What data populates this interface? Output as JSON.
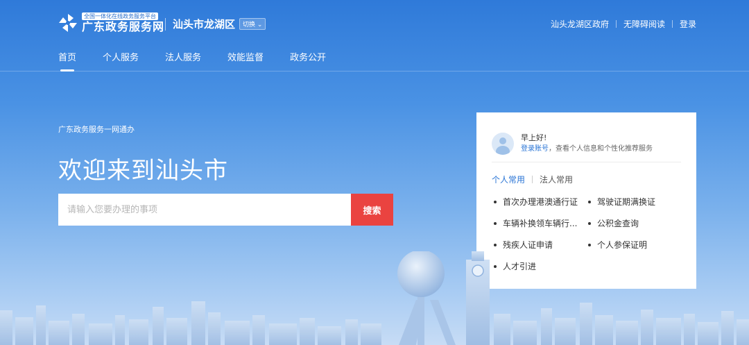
{
  "header": {
    "logo_tag": "全国一体化在线政务服务平台",
    "logo_name": "广东政务服务网",
    "city": "汕头市龙湖区",
    "switch_label": "切换",
    "links": [
      "汕头龙湖区政府",
      "无障碍阅读",
      "登录"
    ]
  },
  "nav": {
    "items": [
      "首页",
      "个人服务",
      "法人服务",
      "效能监督",
      "政务公开"
    ],
    "active": "首页"
  },
  "hero": {
    "subtitle": "广东政务服务一网通办",
    "title": "欢迎来到汕头市"
  },
  "search": {
    "placeholder": "请输入您要办理的事项",
    "button": "搜索"
  },
  "panel": {
    "greeting": "早上好!",
    "login_link": "登录账号",
    "login_desc": "，查看个人信息和个性化推荐服务",
    "tabs": [
      "个人常用",
      "法人常用"
    ],
    "active_tab": "个人常用",
    "services": [
      "首次办理港澳通行证",
      "驾驶证期满换证",
      "车辆补换领车辆行...",
      "公积金查询",
      "残疾人证申请",
      "个人参保证明",
      "人才引进"
    ]
  },
  "colors": {
    "accent": "#2b76d6",
    "search_button": "#ea4340"
  }
}
